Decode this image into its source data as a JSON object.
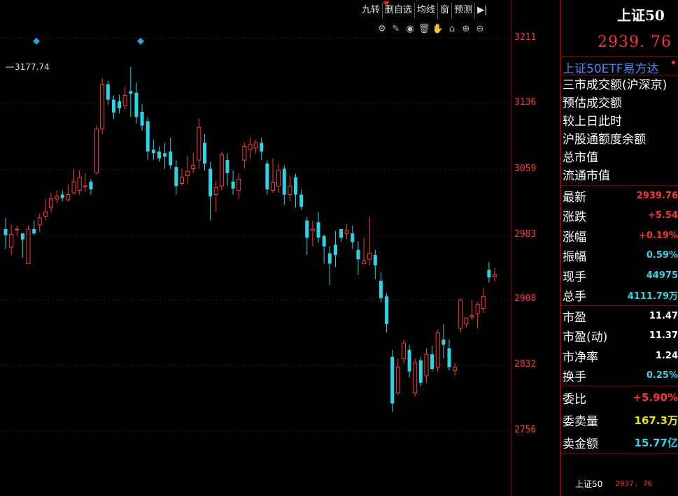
{
  "toolbar": {
    "buttons": [
      "九转",
      "删自选",
      "均线",
      "窗",
      "预测"
    ],
    "pin_icon": "pin-right-icon"
  },
  "draw_tools": [
    {
      "name": "settings-icon",
      "glyph": "⚙"
    },
    {
      "name": "pen-icon",
      "glyph": "✎"
    },
    {
      "name": "eye-icon",
      "glyph": "◉"
    },
    {
      "name": "trash-icon",
      "glyph": "🗑"
    },
    {
      "name": "hand-icon",
      "glyph": "✋"
    },
    {
      "name": "lock-icon",
      "glyph": "⌂"
    },
    {
      "name": "zoom-in-icon",
      "glyph": "⊕"
    },
    {
      "name": "zoom-out-icon",
      "glyph": "⊖"
    }
  ],
  "price_axis": {
    "labels": [
      "3211",
      "3136",
      "3059",
      "2983",
      "2908",
      "2832",
      "2756"
    ],
    "values": [
      3211,
      3136,
      3059,
      2983,
      2908,
      2832,
      2756
    ]
  },
  "chart_data": {
    "type": "candlestick",
    "high_marker": {
      "label": "3177.74",
      "value": 3177.74
    },
    "diamond_markers": 2,
    "up_color": "#ff3b3b",
    "down_color": "#29d6e6",
    "candles": [
      [
        2990,
        2983,
        3003,
        2967
      ],
      [
        2969,
        2984,
        2995,
        2960
      ],
      [
        2990,
        2990,
        2994,
        2982
      ],
      [
        2985,
        2978,
        2985,
        2957
      ],
      [
        2950,
        2990,
        2994,
        2950
      ],
      [
        2990,
        2985,
        3000,
        2983
      ],
      [
        2995,
        3003,
        3008,
        2987
      ],
      [
        3005,
        3010,
        3025,
        3000
      ],
      [
        3015,
        3025,
        3032,
        3009
      ],
      [
        3025,
        3028,
        3035,
        3020
      ],
      [
        3030,
        3026,
        3035,
        3022
      ],
      [
        3024,
        3030,
        3042,
        3022
      ],
      [
        3032,
        3045,
        3060,
        3030
      ],
      [
        3035,
        3050,
        3058,
        3030
      ],
      [
        3040,
        3040,
        3055,
        3033
      ],
      [
        3045,
        3036,
        3048,
        3030
      ],
      [
        3055,
        3106,
        3110,
        3053
      ],
      [
        3106,
        3158,
        3165,
        3100
      ],
      [
        3158,
        3140,
        3162,
        3134
      ],
      [
        3140,
        3125,
        3145,
        3118
      ],
      [
        3138,
        3130,
        3146,
        3124
      ],
      [
        3133,
        3145,
        3155,
        3128
      ],
      [
        3150,
        3147,
        3178,
        3120
      ],
      [
        3148,
        3120,
        3160,
        3112
      ],
      [
        3126,
        3110,
        3135,
        3104
      ],
      [
        3115,
        3080,
        3120,
        3070
      ],
      [
        3082,
        3078,
        3094,
        3070
      ],
      [
        3080,
        3072,
        3086,
        3068
      ],
      [
        3078,
        3074,
        3090,
        3060
      ],
      [
        3080,
        3064,
        3096,
        3060
      ],
      [
        3062,
        3040,
        3070,
        3030
      ],
      [
        3043,
        3050,
        3060,
        3040
      ],
      [
        3052,
        3057,
        3075,
        3042
      ],
      [
        3060,
        3064,
        3078,
        3055
      ],
      [
        3070,
        3108,
        3118,
        3060
      ],
      [
        3090,
        3066,
        3100,
        3058
      ],
      [
        3060,
        3028,
        3068,
        3000
      ],
      [
        3030,
        3038,
        3046,
        3010
      ],
      [
        3040,
        3076,
        3080,
        3035
      ],
      [
        3070,
        3055,
        3078,
        3040
      ],
      [
        3045,
        3037,
        3058,
        3030
      ],
      [
        3035,
        3048,
        3055,
        3025
      ],
      [
        3070,
        3086,
        3090,
        3060
      ],
      [
        3082,
        3088,
        3096,
        3072
      ],
      [
        3084,
        3090,
        3094,
        3078
      ],
      [
        3090,
        3080,
        3096,
        3070
      ],
      [
        3066,
        3036,
        3070,
        3030
      ],
      [
        3035,
        3044,
        3072,
        3032
      ],
      [
        3040,
        3058,
        3066,
        3032
      ],
      [
        3060,
        3030,
        3064,
        3018
      ],
      [
        3030,
        3040,
        3052,
        3022
      ],
      [
        3050,
        3030,
        3054,
        3015
      ],
      [
        3030,
        3016,
        3036,
        3012
      ],
      [
        3000,
        2980,
        3004,
        2960
      ],
      [
        2988,
        2990,
        3000,
        2970
      ],
      [
        2998,
        2980,
        3010,
        2974
      ],
      [
        2982,
        2970,
        2984,
        2950
      ],
      [
        2962,
        2950,
        2970,
        2925
      ],
      [
        2972,
        2960,
        2988,
        2946
      ],
      [
        2990,
        2980,
        2990,
        2975
      ],
      [
        2985,
        2988,
        2996,
        2978
      ],
      [
        2985,
        2975,
        2994,
        2967
      ],
      [
        2966,
        2955,
        2976,
        2937
      ],
      [
        2950,
        2953,
        2980,
        2952
      ],
      [
        2955,
        2962,
        3004,
        2948
      ],
      [
        2960,
        2948,
        2966,
        2932
      ],
      [
        2930,
        2910,
        2940,
        2905
      ],
      [
        2912,
        2880,
        2916,
        2870
      ],
      [
        2842,
        2788,
        2850,
        2778
      ],
      [
        2800,
        2830,
        2840,
        2798
      ],
      [
        2840,
        2858,
        2862,
        2834
      ],
      [
        2850,
        2825,
        2856,
        2818
      ],
      [
        2800,
        2835,
        2840,
        2796
      ],
      [
        2838,
        2812,
        2842,
        2808
      ],
      [
        2820,
        2845,
        2852,
        2812
      ],
      [
        2845,
        2828,
        2855,
        2825
      ],
      [
        2830,
        2870,
        2874,
        2824
      ],
      [
        2862,
        2856,
        2880,
        2840
      ],
      [
        2852,
        2830,
        2862,
        2826
      ],
      [
        2826,
        2830,
        2835,
        2820
      ],
      [
        2875,
        2908,
        2910,
        2870
      ],
      [
        2880,
        2887,
        2888,
        2876
      ],
      [
        2888,
        2890,
        2908,
        2885
      ],
      [
        2892,
        2903,
        2906,
        2875
      ],
      [
        2898,
        2912,
        2922,
        2893
      ],
      [
        2943,
        2934,
        2952,
        2928
      ],
      [
        2935,
        2937,
        2945,
        2929
      ]
    ]
  },
  "quote": {
    "title": "上证50",
    "price": "2939. 76",
    "etf_label": "上证50ETF易方达",
    "info_lines": [
      "三市成交额(沪深京)",
      "预估成交额",
      "较上日此时",
      "沪股通额度余额",
      "总市值",
      "流通市值"
    ],
    "rows1": [
      {
        "label": "最新",
        "value": "2939.76",
        "color": "red"
      },
      {
        "label": "涨跌",
        "value": "+5.54",
        "color": "red"
      },
      {
        "label": "涨幅",
        "value": "+0.19%",
        "color": "red"
      },
      {
        "label": "振幅",
        "value": "0.59%",
        "color": "cyan"
      },
      {
        "label": "现手",
        "value": "44975",
        "color": "cyan"
      },
      {
        "label": "总手",
        "value": "4111.79万",
        "color": "cyan"
      }
    ],
    "rows2": [
      {
        "label": "市盈",
        "value": "11.47",
        "color": "white"
      },
      {
        "label": "市盈(动)",
        "value": "11.37",
        "color": "white"
      },
      {
        "label": "市净率",
        "value": "1.24",
        "color": "white"
      },
      {
        "label": "换手",
        "value": "0.25%",
        "color": "cyan"
      }
    ],
    "rows3": [
      {
        "label": "委比",
        "value": "+5.90%",
        "color": "red"
      },
      {
        "label": "委卖量",
        "value": "167.3万",
        "color": "yellow"
      },
      {
        "label": "卖金额",
        "value": "15.77亿",
        "color": "cyan"
      }
    ],
    "footer_name": "上证50",
    "footer_value": "2937. 76"
  }
}
